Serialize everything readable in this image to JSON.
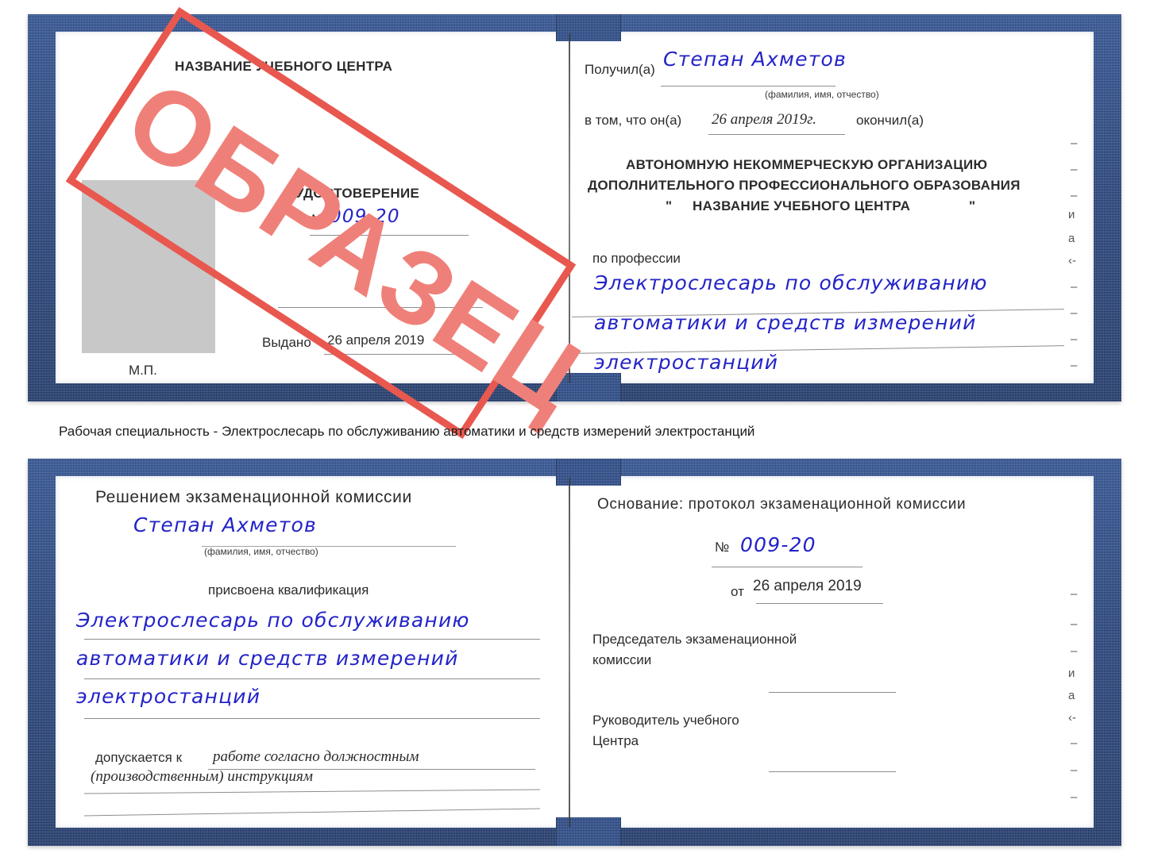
{
  "document": {
    "kind": "Russian vocational training certificate (удостоверение) sample scan",
    "watermark": {
      "text": "ОБРАЗЕЦ",
      "color": "#e8584f",
      "text_color": "#ef8079"
    },
    "cover_color": "#24488c",
    "handwriting_color": "#2323c8"
  },
  "caption": {
    "text": "Рабочая специальность - Электрослесарь по обслуживанию автоматики и средств измерений электростанций"
  },
  "cert_top": {
    "left_page": {
      "center_title": "НАЗВАНИЕ УЧЕБНОГО ЦЕНТРА",
      "doc_type": "УДОСТОВЕРЕНИЕ",
      "number_label": "№",
      "number_value": "009-20",
      "issued_label": "Выдано",
      "issued_value": "26 апреля 2019",
      "seal_label": "М.П."
    },
    "right_page": {
      "received_label": "Получил(а)",
      "received_value": "Степан Ахметов",
      "fio_hint": "(фамилия, имя, отчество)",
      "in_that_label": "в том, что он(а)",
      "date_value": "26 апреля 2019г.",
      "finished_label": "окончил(а)",
      "org_line1": "АВТОНОМНУЮ НЕКОММЕРЧЕСКУЮ ОРГАНИЗАЦИЮ",
      "org_line2": "ДОПОЛНИТЕЛЬНОГО ПРОФЕССИОНАЛЬНОГО ОБРАЗОВАНИЯ",
      "org_quote_open": "\"",
      "org_line3": "НАЗВАНИЕ УЧЕБНОГО ЦЕНТРА",
      "org_quote_close": "\"",
      "profession_label": "по профессии",
      "profession_line1": "Электрослесарь по обслуживанию",
      "profession_line2": "автоматики и средств измерений",
      "profession_line3": "электростанций"
    },
    "edge_fragments": [
      "–",
      "–",
      "–",
      "–",
      "и",
      "а",
      "‹-",
      "–",
      "–",
      "–",
      "–"
    ]
  },
  "cert_bottom": {
    "left_page": {
      "heading": "Решением экзаменационной комиссии",
      "name_value": "Степан Ахметов",
      "fio_hint": "(фамилия, имя, отчество)",
      "qualification_label": "присвоена квалификация",
      "qualification_line1": "Электрослесарь по обслуживанию",
      "qualification_line2": "автоматики и средств измерений",
      "qualification_line3": "электростанций",
      "admitted_label": "допускается к",
      "admitted_value_line1": "работе согласно должностным",
      "admitted_value_line2": "(производственным) инструкциям"
    },
    "right_page": {
      "basis_label": "Основание: протокол экзаменационной комиссии",
      "number_label": "№",
      "number_value": "009-20",
      "date_label": "от",
      "date_value": "26 апреля 2019",
      "chairman_line1": "Председатель экзаменационной",
      "chairman_line2": "комиссии",
      "head_line1": "Руководитель учебного",
      "head_line2": "Центра"
    },
    "edge_fragments": [
      "–",
      "–",
      "–",
      "и",
      "а",
      "‹-",
      "–",
      "–",
      "–",
      "–"
    ]
  }
}
